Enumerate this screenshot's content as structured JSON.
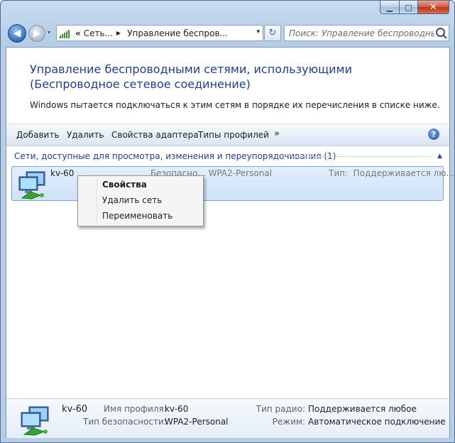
{
  "window": {
    "controls": {
      "minimize": "▁",
      "maximize": "□",
      "close": "✕"
    }
  },
  "nav": {
    "back_glyph": "◀",
    "forward_glyph": "▶",
    "history_glyph": "▾",
    "breadcrumb": {
      "overflow": "«",
      "items": [
        "Сеть...",
        "Управление беспров..."
      ],
      "separator": "▶"
    },
    "refresh_glyph": "↻",
    "search_placeholder": "Поиск: Управление беспроводными ..."
  },
  "page": {
    "title": "Управление беспроводными сетями, использующими (Беспроводное сетевое соединение)",
    "description": "Windows пытается подключаться к этим сетям в порядке их перечисления в списке ниже."
  },
  "toolbar": {
    "items": [
      "Добавить",
      "Удалить",
      "Свойства адаптера",
      "Типы профилей"
    ],
    "more": "»",
    "help": "?"
  },
  "group": {
    "header": "Сети, доступные для просмотра, изменения и переупорядочивания (1)",
    "collapse_glyph": "▲"
  },
  "network": {
    "name": "kv-60",
    "security": "Безопасно... WPA2-Personal",
    "type_label": "Тип:",
    "type_value": "Поддерживается лю..."
  },
  "context_menu": {
    "items": [
      "Свойства",
      "Удалить сеть",
      "Переименовать"
    ]
  },
  "details": {
    "name": "kv-60",
    "profile_label": "Имя профиля:",
    "profile_value": "kv-60",
    "security_label": "Тип безопасности:",
    "security_value": "WPA2-Personal",
    "radio_label": "Тип радио:",
    "radio_value": "Поддерживается любое",
    "mode_label": "Режим:",
    "mode_value": "Автоматическое подключение"
  },
  "colors": {
    "title_blue": "#1c3f94",
    "selection": "#cfe2f8",
    "close_red": "#be3318"
  }
}
